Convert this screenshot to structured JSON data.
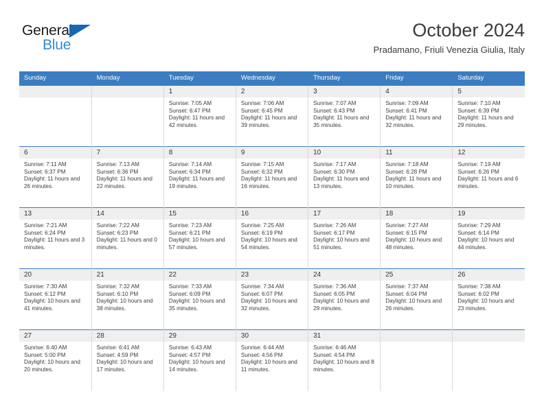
{
  "brand": {
    "line1": "General",
    "line2": "Blue",
    "triangle_color": "#1668b3",
    "line2_color": "#2e8bd4"
  },
  "header": {
    "title": "October 2024",
    "subtitle": "Pradamano, Friuli Venezia Giulia, Italy"
  },
  "theme": {
    "header_blue": "#3b7dc0",
    "daynum_gray": "#efefef",
    "text": "#333333"
  },
  "calendar": {
    "weekday_headers": [
      "Sunday",
      "Monday",
      "Tuesday",
      "Wednesday",
      "Thursday",
      "Friday",
      "Saturday"
    ],
    "weeks": [
      [
        {
          "day": "",
          "empty": true
        },
        {
          "day": "",
          "empty": true
        },
        {
          "day": "1",
          "sunrise": "Sunrise: 7:05 AM",
          "sunset": "Sunset: 6:47 PM",
          "daylight": "Daylight: 11 hours and 42 minutes."
        },
        {
          "day": "2",
          "sunrise": "Sunrise: 7:06 AM",
          "sunset": "Sunset: 6:45 PM",
          "daylight": "Daylight: 11 hours and 39 minutes."
        },
        {
          "day": "3",
          "sunrise": "Sunrise: 7:07 AM",
          "sunset": "Sunset: 6:43 PM",
          "daylight": "Daylight: 11 hours and 35 minutes."
        },
        {
          "day": "4",
          "sunrise": "Sunrise: 7:09 AM",
          "sunset": "Sunset: 6:41 PM",
          "daylight": "Daylight: 11 hours and 32 minutes."
        },
        {
          "day": "5",
          "sunrise": "Sunrise: 7:10 AM",
          "sunset": "Sunset: 6:39 PM",
          "daylight": "Daylight: 11 hours and 29 minutes."
        }
      ],
      [
        {
          "day": "6",
          "sunrise": "Sunrise: 7:11 AM",
          "sunset": "Sunset: 6:37 PM",
          "daylight": "Daylight: 11 hours and 26 minutes."
        },
        {
          "day": "7",
          "sunrise": "Sunrise: 7:13 AM",
          "sunset": "Sunset: 6:36 PM",
          "daylight": "Daylight: 11 hours and 22 minutes."
        },
        {
          "day": "8",
          "sunrise": "Sunrise: 7:14 AM",
          "sunset": "Sunset: 6:34 PM",
          "daylight": "Daylight: 11 hours and 19 minutes."
        },
        {
          "day": "9",
          "sunrise": "Sunrise: 7:15 AM",
          "sunset": "Sunset: 6:32 PM",
          "daylight": "Daylight: 11 hours and 16 minutes."
        },
        {
          "day": "10",
          "sunrise": "Sunrise: 7:17 AM",
          "sunset": "Sunset: 6:30 PM",
          "daylight": "Daylight: 11 hours and 13 minutes."
        },
        {
          "day": "11",
          "sunrise": "Sunrise: 7:18 AM",
          "sunset": "Sunset: 6:28 PM",
          "daylight": "Daylight: 11 hours and 10 minutes."
        },
        {
          "day": "12",
          "sunrise": "Sunrise: 7:19 AM",
          "sunset": "Sunset: 6:26 PM",
          "daylight": "Daylight: 11 hours and 6 minutes."
        }
      ],
      [
        {
          "day": "13",
          "sunrise": "Sunrise: 7:21 AM",
          "sunset": "Sunset: 6:24 PM",
          "daylight": "Daylight: 11 hours and 3 minutes."
        },
        {
          "day": "14",
          "sunrise": "Sunrise: 7:22 AM",
          "sunset": "Sunset: 6:23 PM",
          "daylight": "Daylight: 11 hours and 0 minutes."
        },
        {
          "day": "15",
          "sunrise": "Sunrise: 7:23 AM",
          "sunset": "Sunset: 6:21 PM",
          "daylight": "Daylight: 10 hours and 57 minutes."
        },
        {
          "day": "16",
          "sunrise": "Sunrise: 7:25 AM",
          "sunset": "Sunset: 6:19 PM",
          "daylight": "Daylight: 10 hours and 54 minutes."
        },
        {
          "day": "17",
          "sunrise": "Sunrise: 7:26 AM",
          "sunset": "Sunset: 6:17 PM",
          "daylight": "Daylight: 10 hours and 51 minutes."
        },
        {
          "day": "18",
          "sunrise": "Sunrise: 7:27 AM",
          "sunset": "Sunset: 6:15 PM",
          "daylight": "Daylight: 10 hours and 48 minutes."
        },
        {
          "day": "19",
          "sunrise": "Sunrise: 7:29 AM",
          "sunset": "Sunset: 6:14 PM",
          "daylight": "Daylight: 10 hours and 44 minutes."
        }
      ],
      [
        {
          "day": "20",
          "sunrise": "Sunrise: 7:30 AM",
          "sunset": "Sunset: 6:12 PM",
          "daylight": "Daylight: 10 hours and 41 minutes."
        },
        {
          "day": "21",
          "sunrise": "Sunrise: 7:32 AM",
          "sunset": "Sunset: 6:10 PM",
          "daylight": "Daylight: 10 hours and 38 minutes."
        },
        {
          "day": "22",
          "sunrise": "Sunrise: 7:33 AM",
          "sunset": "Sunset: 6:09 PM",
          "daylight": "Daylight: 10 hours and 35 minutes."
        },
        {
          "day": "23",
          "sunrise": "Sunrise: 7:34 AM",
          "sunset": "Sunset: 6:07 PM",
          "daylight": "Daylight: 10 hours and 32 minutes."
        },
        {
          "day": "24",
          "sunrise": "Sunrise: 7:36 AM",
          "sunset": "Sunset: 6:05 PM",
          "daylight": "Daylight: 10 hours and 29 minutes."
        },
        {
          "day": "25",
          "sunrise": "Sunrise: 7:37 AM",
          "sunset": "Sunset: 6:04 PM",
          "daylight": "Daylight: 10 hours and 26 minutes."
        },
        {
          "day": "26",
          "sunrise": "Sunrise: 7:38 AM",
          "sunset": "Sunset: 6:02 PM",
          "daylight": "Daylight: 10 hours and 23 minutes."
        }
      ],
      [
        {
          "day": "27",
          "sunrise": "Sunrise: 6:40 AM",
          "sunset": "Sunset: 5:00 PM",
          "daylight": "Daylight: 10 hours and 20 minutes."
        },
        {
          "day": "28",
          "sunrise": "Sunrise: 6:41 AM",
          "sunset": "Sunset: 4:59 PM",
          "daylight": "Daylight: 10 hours and 17 minutes."
        },
        {
          "day": "29",
          "sunrise": "Sunrise: 6:43 AM",
          "sunset": "Sunset: 4:57 PM",
          "daylight": "Daylight: 10 hours and 14 minutes."
        },
        {
          "day": "30",
          "sunrise": "Sunrise: 6:44 AM",
          "sunset": "Sunset: 4:56 PM",
          "daylight": "Daylight: 10 hours and 11 minutes."
        },
        {
          "day": "31",
          "sunrise": "Sunrise: 6:46 AM",
          "sunset": "Sunset: 4:54 PM",
          "daylight": "Daylight: 10 hours and 8 minutes."
        },
        {
          "day": "",
          "empty": true
        },
        {
          "day": "",
          "empty": true
        }
      ]
    ]
  }
}
